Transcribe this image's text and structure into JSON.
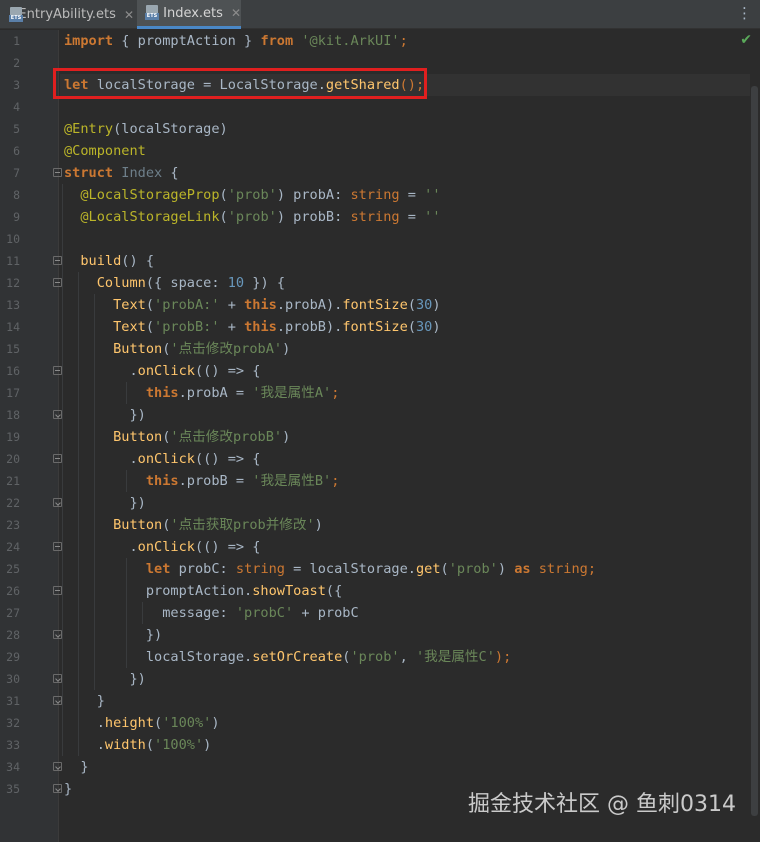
{
  "tabs": [
    {
      "label": "EntryAbility.ets",
      "active": false
    },
    {
      "label": "Index.ets",
      "active": true
    }
  ],
  "icons": {
    "file": "ets-file-icon",
    "close": "close-icon",
    "menu": "more-vertical-icon",
    "status": "check-icon"
  },
  "status": {
    "check": "✔"
  },
  "gutter": {
    "line_numbers": [
      "1",
      "2",
      "3",
      "4",
      "5",
      "6",
      "7",
      "8",
      "9",
      "10",
      "11",
      "12",
      "13",
      "14",
      "15",
      "16",
      "17",
      "18",
      "19",
      "20",
      "21",
      "22",
      "23",
      "24",
      "25",
      "26",
      "27",
      "28",
      "29",
      "30",
      "31",
      "32",
      "33",
      "34",
      "35"
    ]
  },
  "code": {
    "lines": [
      [
        {
          "t": "import",
          "c": "kwb"
        },
        {
          "t": " { promptAction } ",
          "c": "white"
        },
        {
          "t": "from",
          "c": "kwb"
        },
        {
          "t": " ",
          "c": "white"
        },
        {
          "t": "'@kit.ArkUI'",
          "c": "str"
        },
        {
          "t": ";",
          "c": "kw"
        }
      ],
      [],
      [
        {
          "t": "let",
          "c": "kwb"
        },
        {
          "t": " localStorage = LocalStorage.",
          "c": "white"
        },
        {
          "t": "getShared",
          "c": "fn"
        },
        {
          "t": "();",
          "c": "kw"
        }
      ],
      [],
      [
        {
          "t": "@Entry",
          "c": "dec"
        },
        {
          "t": "(localStorage)",
          "c": "white"
        }
      ],
      [
        {
          "t": "@Component",
          "c": "dec"
        }
      ],
      [
        {
          "t": "struct",
          "c": "kwb"
        },
        {
          "t": " ",
          "c": "white"
        },
        {
          "t": "Index",
          "c": "gray"
        },
        {
          "t": " {",
          "c": "white"
        }
      ],
      [
        {
          "t": "  ",
          "c": "white"
        },
        {
          "t": "@LocalStorageProp",
          "c": "dec"
        },
        {
          "t": "(",
          "c": "white"
        },
        {
          "t": "'prob'",
          "c": "str"
        },
        {
          "t": ") probA: ",
          "c": "white"
        },
        {
          "t": "string",
          "c": "kw"
        },
        {
          "t": " = ",
          "c": "white"
        },
        {
          "t": "''",
          "c": "str"
        }
      ],
      [
        {
          "t": "  ",
          "c": "white"
        },
        {
          "t": "@LocalStorageLink",
          "c": "dec"
        },
        {
          "t": "(",
          "c": "white"
        },
        {
          "t": "'prob'",
          "c": "str"
        },
        {
          "t": ") probB: ",
          "c": "white"
        },
        {
          "t": "string",
          "c": "kw"
        },
        {
          "t": " = ",
          "c": "white"
        },
        {
          "t": "''",
          "c": "str"
        }
      ],
      [],
      [
        {
          "t": "  ",
          "c": "white"
        },
        {
          "t": "build",
          "c": "fn"
        },
        {
          "t": "() {",
          "c": "white"
        }
      ],
      [
        {
          "t": "    ",
          "c": "white"
        },
        {
          "t": "Column",
          "c": "fn"
        },
        {
          "t": "({ space: ",
          "c": "white"
        },
        {
          "t": "10",
          "c": "num"
        },
        {
          "t": " }) {",
          "c": "white"
        }
      ],
      [
        {
          "t": "      ",
          "c": "white"
        },
        {
          "t": "Text",
          "c": "fn"
        },
        {
          "t": "(",
          "c": "white"
        },
        {
          "t": "'probA:'",
          "c": "str"
        },
        {
          "t": " + ",
          "c": "white"
        },
        {
          "t": "this",
          "c": "kwb"
        },
        {
          "t": ".probA).",
          "c": "white"
        },
        {
          "t": "fontSize",
          "c": "fn"
        },
        {
          "t": "(",
          "c": "white"
        },
        {
          "t": "30",
          "c": "num"
        },
        {
          "t": ")",
          "c": "white"
        }
      ],
      [
        {
          "t": "      ",
          "c": "white"
        },
        {
          "t": "Text",
          "c": "fn"
        },
        {
          "t": "(",
          "c": "white"
        },
        {
          "t": "'probB:'",
          "c": "str"
        },
        {
          "t": " + ",
          "c": "white"
        },
        {
          "t": "this",
          "c": "kwb"
        },
        {
          "t": ".probB).",
          "c": "white"
        },
        {
          "t": "fontSize",
          "c": "fn"
        },
        {
          "t": "(",
          "c": "white"
        },
        {
          "t": "30",
          "c": "num"
        },
        {
          "t": ")",
          "c": "white"
        }
      ],
      [
        {
          "t": "      ",
          "c": "white"
        },
        {
          "t": "Button",
          "c": "fn"
        },
        {
          "t": "(",
          "c": "white"
        },
        {
          "t": "'点击修改probA'",
          "c": "str"
        },
        {
          "t": ")",
          "c": "white"
        }
      ],
      [
        {
          "t": "        .",
          "c": "white"
        },
        {
          "t": "onClick",
          "c": "fn"
        },
        {
          "t": "(() => {",
          "c": "white"
        }
      ],
      [
        {
          "t": "          ",
          "c": "white"
        },
        {
          "t": "this",
          "c": "kwb"
        },
        {
          "t": ".probA = ",
          "c": "white"
        },
        {
          "t": "'我是属性A'",
          "c": "str"
        },
        {
          "t": ";",
          "c": "kw"
        }
      ],
      [
        {
          "t": "        })",
          "c": "white"
        }
      ],
      [
        {
          "t": "      ",
          "c": "white"
        },
        {
          "t": "Button",
          "c": "fn"
        },
        {
          "t": "(",
          "c": "white"
        },
        {
          "t": "'点击修改probB'",
          "c": "str"
        },
        {
          "t": ")",
          "c": "white"
        }
      ],
      [
        {
          "t": "        .",
          "c": "white"
        },
        {
          "t": "onClick",
          "c": "fn"
        },
        {
          "t": "(() => {",
          "c": "white"
        }
      ],
      [
        {
          "t": "          ",
          "c": "white"
        },
        {
          "t": "this",
          "c": "kwb"
        },
        {
          "t": ".probB = ",
          "c": "white"
        },
        {
          "t": "'我是属性B'",
          "c": "str"
        },
        {
          "t": ";",
          "c": "kw"
        }
      ],
      [
        {
          "t": "        })",
          "c": "white"
        }
      ],
      [
        {
          "t": "      ",
          "c": "white"
        },
        {
          "t": "Button",
          "c": "fn"
        },
        {
          "t": "(",
          "c": "white"
        },
        {
          "t": "'点击获取prob并修改'",
          "c": "str"
        },
        {
          "t": ")",
          "c": "white"
        }
      ],
      [
        {
          "t": "        .",
          "c": "white"
        },
        {
          "t": "onClick",
          "c": "fn"
        },
        {
          "t": "(() => {",
          "c": "white"
        }
      ],
      [
        {
          "t": "          ",
          "c": "white"
        },
        {
          "t": "let",
          "c": "kwb"
        },
        {
          "t": " probC: ",
          "c": "white"
        },
        {
          "t": "string",
          "c": "kw"
        },
        {
          "t": " = localStorage.",
          "c": "white"
        },
        {
          "t": "get",
          "c": "fn"
        },
        {
          "t": "(",
          "c": "white"
        },
        {
          "t": "'prob'",
          "c": "str"
        },
        {
          "t": ") ",
          "c": "white"
        },
        {
          "t": "as",
          "c": "kwb"
        },
        {
          "t": " ",
          "c": "white"
        },
        {
          "t": "string",
          "c": "kw"
        },
        {
          "t": ";",
          "c": "kw"
        }
      ],
      [
        {
          "t": "          promptAction.",
          "c": "white"
        },
        {
          "t": "showToast",
          "c": "fn"
        },
        {
          "t": "({",
          "c": "white"
        }
      ],
      [
        {
          "t": "            message: ",
          "c": "white"
        },
        {
          "t": "'probC'",
          "c": "str"
        },
        {
          "t": " + probC",
          "c": "white"
        }
      ],
      [
        {
          "t": "          })",
          "c": "white"
        }
      ],
      [
        {
          "t": "          localStorage.",
          "c": "white"
        },
        {
          "t": "setOrCreate",
          "c": "fn"
        },
        {
          "t": "(",
          "c": "white"
        },
        {
          "t": "'prob'",
          "c": "str"
        },
        {
          "t": ", ",
          "c": "white"
        },
        {
          "t": "'我是属性C'",
          "c": "str"
        },
        {
          "t": ");",
          "c": "kw"
        }
      ],
      [
        {
          "t": "        })",
          "c": "white"
        }
      ],
      [
        {
          "t": "    }",
          "c": "white"
        }
      ],
      [
        {
          "t": "    .",
          "c": "white"
        },
        {
          "t": "height",
          "c": "fn"
        },
        {
          "t": "(",
          "c": "white"
        },
        {
          "t": "'100%'",
          "c": "str"
        },
        {
          "t": ")",
          "c": "white"
        }
      ],
      [
        {
          "t": "    .",
          "c": "white"
        },
        {
          "t": "width",
          "c": "fn"
        },
        {
          "t": "(",
          "c": "white"
        },
        {
          "t": "'100%'",
          "c": "str"
        },
        {
          "t": ")",
          "c": "white"
        }
      ],
      [
        {
          "t": "  }",
          "c": "white"
        }
      ],
      [
        {
          "t": "}",
          "c": "white"
        }
      ]
    ],
    "current_line": 3,
    "fold_open": [
      7,
      11,
      12,
      16,
      20,
      24,
      26
    ],
    "fold_close": [
      18,
      22,
      28,
      30,
      31,
      34,
      35
    ]
  },
  "watermark": {
    "text": "掘金技术社区 @ 鱼刺0314"
  },
  "colors": {
    "highlight_box": "#e01f1f",
    "active_tab_underline": "#4a88c7"
  }
}
